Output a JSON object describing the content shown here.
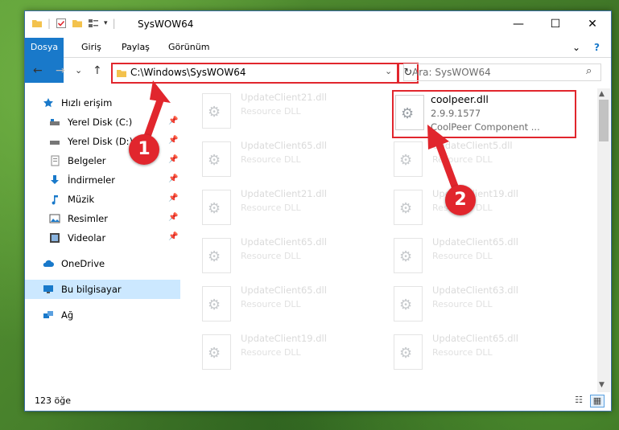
{
  "window": {
    "title": "SysWOW64",
    "minimize": "—",
    "maximize": "☐",
    "close": "✕"
  },
  "ribbon": {
    "file": "Dosya",
    "home": "Giriş",
    "share": "Paylaş",
    "view": "Görünüm",
    "expand": "⌄",
    "help": "?"
  },
  "nav": {
    "back": "←",
    "forward": "→",
    "dropdown": "⌄",
    "up": "↑",
    "address": "C:\\Windows\\SysWOW64",
    "address_dropdown": "⌄",
    "refresh": "↻",
    "search_placeholder": "Ara: SysWOW64",
    "search_icon": "⌕"
  },
  "sidebar": {
    "quick_access": "Hızlı erişim",
    "items": [
      {
        "label": "Yerel Disk (C:)",
        "icon": "drive-icon"
      },
      {
        "label": "Yerel Disk (D:)",
        "icon": "drive-icon"
      },
      {
        "label": "Belgeler",
        "icon": "documents-icon"
      },
      {
        "label": "İndirmeler",
        "icon": "download-icon"
      },
      {
        "label": "Müzik",
        "icon": "music-icon"
      },
      {
        "label": "Resimler",
        "icon": "pictures-icon"
      },
      {
        "label": "Videolar",
        "icon": "videos-icon"
      }
    ],
    "onedrive": "OneDrive",
    "this_pc": "Bu bilgisayar",
    "network": "Ağ",
    "pin_glyph": "📌"
  },
  "files": {
    "highlighted": {
      "name": "coolpeer.dll",
      "version": "2.9.9.1577",
      "desc": "CoolPeer Component ..."
    },
    "left": [
      {
        "name": "UpdateClient21.dll",
        "desc": "Resource DLL"
      },
      {
        "name": "UpdateClient65.dll",
        "desc": "Resource DLL"
      },
      {
        "name": "UpdateClient21.dll",
        "desc": "Resource DLL"
      },
      {
        "name": "UpdateClient65.dll",
        "desc": "Resource DLL"
      },
      {
        "name": "UpdateClient65.dll",
        "desc": "Resource DLL"
      },
      {
        "name": "UpdateClient19.dll",
        "desc": "Resource DLL"
      }
    ],
    "right": [
      {
        "name": "UpdateClient5.dll",
        "desc": "Resource DLL"
      },
      {
        "name": "UpdateClient19.dll",
        "desc": "Resource DLL"
      },
      {
        "name": "UpdateClient65.dll",
        "desc": "Resource DLL"
      },
      {
        "name": "UpdateClient63.dll",
        "desc": "Resource DLL"
      },
      {
        "name": "UpdateClient65.dll",
        "desc": "Resource DLL"
      }
    ]
  },
  "scroll": {
    "up": "▲",
    "down": "▼"
  },
  "status": {
    "count": "123 öğe",
    "details_view": "☷",
    "large_icons_view": "▦"
  },
  "callouts": {
    "one": "1",
    "two": "2"
  },
  "colors": {
    "accent": "#1979ca",
    "highlight": "#e1262d",
    "selection": "#cce8ff"
  }
}
